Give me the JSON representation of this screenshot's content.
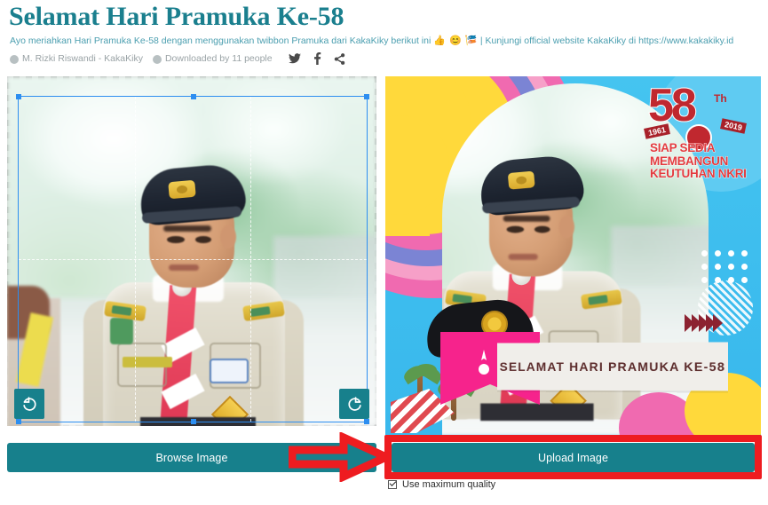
{
  "header": {
    "title": "Selamat Hari Pramuka Ke-58",
    "subtitle_pre": "Ayo meriahkan Hari Pramuka Ke-58 dengan menggunakan twibbon Pramuka dari KakaKiky berikut ini ",
    "subtitle_emoji": "👍 😊 🎏",
    "subtitle_post": " | Kunjungi official website KakaKiky di https://www.kakakiky.id",
    "author": "M. Rizki Riswandi - KakaKiky",
    "downloads": "Downloaded by 11 people",
    "social": [
      "twitter-icon",
      "facebook-icon",
      "share-icon"
    ]
  },
  "editor": {
    "rotate_left_label": "↺",
    "rotate_right_label": "↻",
    "browse_label": "Browse Image",
    "upload_label": "Upload Image",
    "checkbox_label": "Use maximum quality",
    "checkbox_checked": true
  },
  "twibbon": {
    "logo_number": "58",
    "logo_th": "Th",
    "year_start": "1961",
    "year_end": "2019",
    "slogan": "SIAP SEDIA MEMBANGUN KEUTUHAN NKRI",
    "banner_text": "SELAMAT HARI PRAMUKA KE-58"
  },
  "colors": {
    "teal": "#17808c",
    "title_teal": "#1a7f8e",
    "subtitle_teal": "#4c9fb0",
    "highlight_red": "#ee1c20",
    "crop_blue": "#2d8ef0",
    "twibbon_cyan": "#3ec1ef",
    "twibbon_pink": "#f6238c",
    "twibbon_yellow": "#ffd93b",
    "logo_red": "#c0282f"
  }
}
